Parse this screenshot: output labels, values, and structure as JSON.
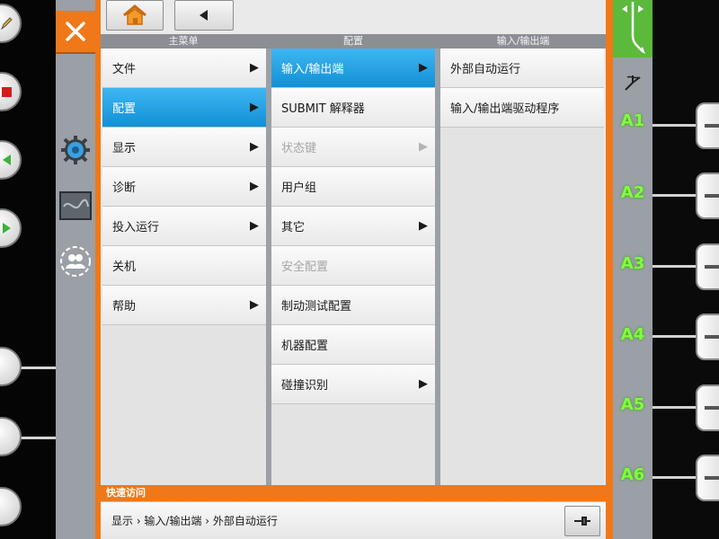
{
  "toolbar": {
    "home_icon": "home-icon",
    "back_icon": "back-arrow-icon"
  },
  "columns": {
    "main_menu_header": "主菜单",
    "config_header": "配置",
    "io_header": "输入/输出端"
  },
  "main_menu": [
    {
      "label": "文件",
      "arrow": "▶"
    },
    {
      "label": "配置",
      "arrow": "▶",
      "active": true
    },
    {
      "label": "显示",
      "arrow": "▶"
    },
    {
      "label": "诊断",
      "arrow": "▶"
    },
    {
      "label": "投入运行",
      "arrow": "▶"
    },
    {
      "label": "关机",
      "arrow": ""
    },
    {
      "label": "帮助",
      "arrow": "▶"
    }
  ],
  "config_menu": [
    {
      "label": "输入/输出端",
      "arrow": "▶",
      "active": true
    },
    {
      "label": "SUBMIT 解释器",
      "arrow": ""
    },
    {
      "label": "状态键",
      "arrow": "▶",
      "disabled": true
    },
    {
      "label": "用户组",
      "arrow": ""
    },
    {
      "label": "其它",
      "arrow": "▶"
    },
    {
      "label": "安全配置",
      "arrow": "",
      "disabled": true
    },
    {
      "label": "制动测试配置",
      "arrow": ""
    },
    {
      "label": "机器配置",
      "arrow": ""
    },
    {
      "label": "碰撞识别",
      "arrow": "▶"
    }
  ],
  "io_menu": [
    {
      "label": "外部自动运行"
    },
    {
      "label": "输入/输出端驱动程序"
    }
  ],
  "quick_access": {
    "title": "快速访问",
    "path": "显示 › 输入/输出端 › 外部自动运行"
  },
  "axes": {
    "labels": [
      "A1",
      "A2",
      "A3",
      "A4",
      "A5",
      "A6"
    ],
    "label_color": "#7fff3a"
  },
  "colors": {
    "accent_orange": "#f07818",
    "selection_blue": "#1fa3e6"
  }
}
